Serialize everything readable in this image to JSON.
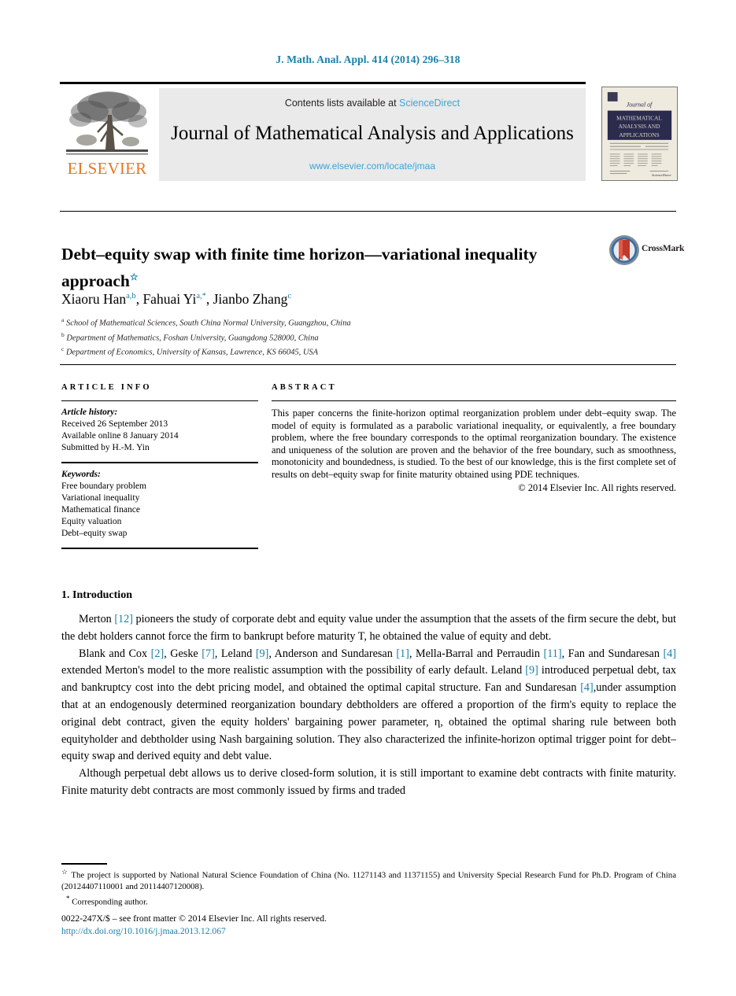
{
  "running_head": "J. Math. Anal. Appl. 414 (2014) 296–318",
  "masthead": {
    "contents_prefix": "Contents lists available at ",
    "sciencedirect": "ScienceDirect",
    "journal_title": "Journal of Mathematical Analysis and Applications",
    "journal_url": "www.elsevier.com/locate/jmaa",
    "publisher_word": "ELSEVIER",
    "cover": {
      "line1": "Journal of",
      "line2": "MATHEMATICAL",
      "line3": "ANALYSIS AND",
      "line4": "APPLICATIONS"
    }
  },
  "title": {
    "text": "Debt–equity swap with finite time horizon—variational inequality approach",
    "star": "☆"
  },
  "crossmark": {
    "label": "CrossMark"
  },
  "authors": {
    "list": "Xiaoru Han a,b, Fahuai Yi a,*, Jianbo Zhang c",
    "names": [
      {
        "name": "Xiaoru Han",
        "sup": "a,b"
      },
      {
        "name": "Fahuai Yi",
        "sup": "a,*"
      },
      {
        "name": "Jianbo Zhang",
        "sup": "c"
      }
    ]
  },
  "affiliations": [
    {
      "mark": "a",
      "text": "School of Mathematical Sciences, South China Normal University, Guangzhou, China"
    },
    {
      "mark": "b",
      "text": "Department of Mathematics, Foshan University, Guangdong 528000, China"
    },
    {
      "mark": "c",
      "text": "Department of Economics, University of Kansas, Lawrence, KS 66045, USA"
    }
  ],
  "article_info": {
    "heading": "ARTICLE INFO",
    "history_label": "Article history:",
    "received": "Received 26 September 2013",
    "available": "Available online 8 January 2014",
    "submitted": "Submitted by H.-M. Yin",
    "keywords_label": "Keywords:",
    "keywords": [
      "Free boundary problem",
      "Variational inequality",
      "Mathematical finance",
      "Equity valuation",
      "Debt–equity swap"
    ]
  },
  "abstract": {
    "heading": "ABSTRACT",
    "text": "This paper concerns the finite-horizon optimal reorganization problem under debt–equity swap. The model of equity is formulated as a parabolic variational inequality, or equivalently, a free boundary problem, where the free boundary corresponds to the optimal reorganization boundary. The existence and uniqueness of the solution are proven and the behavior of the free boundary, such as smoothness, monotonicity and boundedness, is studied. To the best of our knowledge, this is the first complete set of results on debt–equity swap for finite maturity obtained using PDE techniques.",
    "copyright": "© 2014 Elsevier Inc. All rights reserved."
  },
  "section": {
    "intro_heading": "1. Introduction"
  },
  "paragraphs": [
    {
      "id": "p1",
      "parts": [
        {
          "t": "Merton "
        },
        {
          "t": "[12]",
          "ref": true
        },
        {
          "t": " pioneers the study of corporate debt and equity value under the assumption that the assets of the firm secure the debt, but the debt holders cannot force the firm to bankrupt before maturity T, he obtained the value of equity and debt."
        }
      ]
    },
    {
      "id": "p2",
      "parts": [
        {
          "t": "Blank and Cox "
        },
        {
          "t": "[2]",
          "ref": true
        },
        {
          "t": ", Geske "
        },
        {
          "t": "[7]",
          "ref": true
        },
        {
          "t": ", Leland "
        },
        {
          "t": "[9]",
          "ref": true
        },
        {
          "t": ", Anderson and Sundaresan "
        },
        {
          "t": "[1]",
          "ref": true
        },
        {
          "t": ", Mella-Barral and Perraudin "
        },
        {
          "t": "[11]",
          "ref": true
        },
        {
          "t": ", Fan and Sundaresan "
        },
        {
          "t": "[4]",
          "ref": true
        },
        {
          "t": " extended Merton's model to the more realistic assumption with the possibility of early default. Leland "
        },
        {
          "t": "[9]",
          "ref": true
        },
        {
          "t": " introduced perpetual debt, tax and bankruptcy cost into the debt pricing model, and obtained the optimal capital structure. Fan and Sundaresan "
        },
        {
          "t": "[4]",
          "ref": true
        },
        {
          "t": ",under assumption that at an endogenously determined reorganization boundary debtholders are offered a proportion of the firm's equity to replace the original debt contract, given the equity holders' bargaining power parameter, η, obtained the optimal sharing rule between both equityholder and debtholder using Nash bargaining solution. They also characterized the infinite-horizon optimal trigger point for debt–equity swap and derived equity and debt value."
        }
      ]
    },
    {
      "id": "p3",
      "parts": [
        {
          "t": "Although perpetual debt allows us to derive closed-form solution, it is still important to examine debt contracts with finite maturity. Finite maturity debt contracts are most commonly issued by firms and traded"
        }
      ]
    }
  ],
  "footnotes": {
    "grant": "The project is supported by National Natural Science Foundation of China (No. 11271143 and 11371155) and University Special Research Fund for Ph.D. Program of China (20124407110001 and 20114407120008).",
    "grant_mark": "☆",
    "corresponding": "Corresponding author.",
    "corresponding_mark": "*"
  },
  "imprint": {
    "front_matter": "0022-247X/$ – see front matter © 2014 Elsevier Inc. All rights reserved.",
    "doi": "http://dx.doi.org/10.1016/j.jmaa.2013.12.067"
  },
  "colors": {
    "link_blue": "#1a7fa8",
    "sd_blue": "#3aa4d8",
    "elsevier_orange": "#e87722",
    "band_gray": "#eaeaea",
    "cover_navy": "#2b2b4e",
    "cover_cream": "#efeade"
  }
}
